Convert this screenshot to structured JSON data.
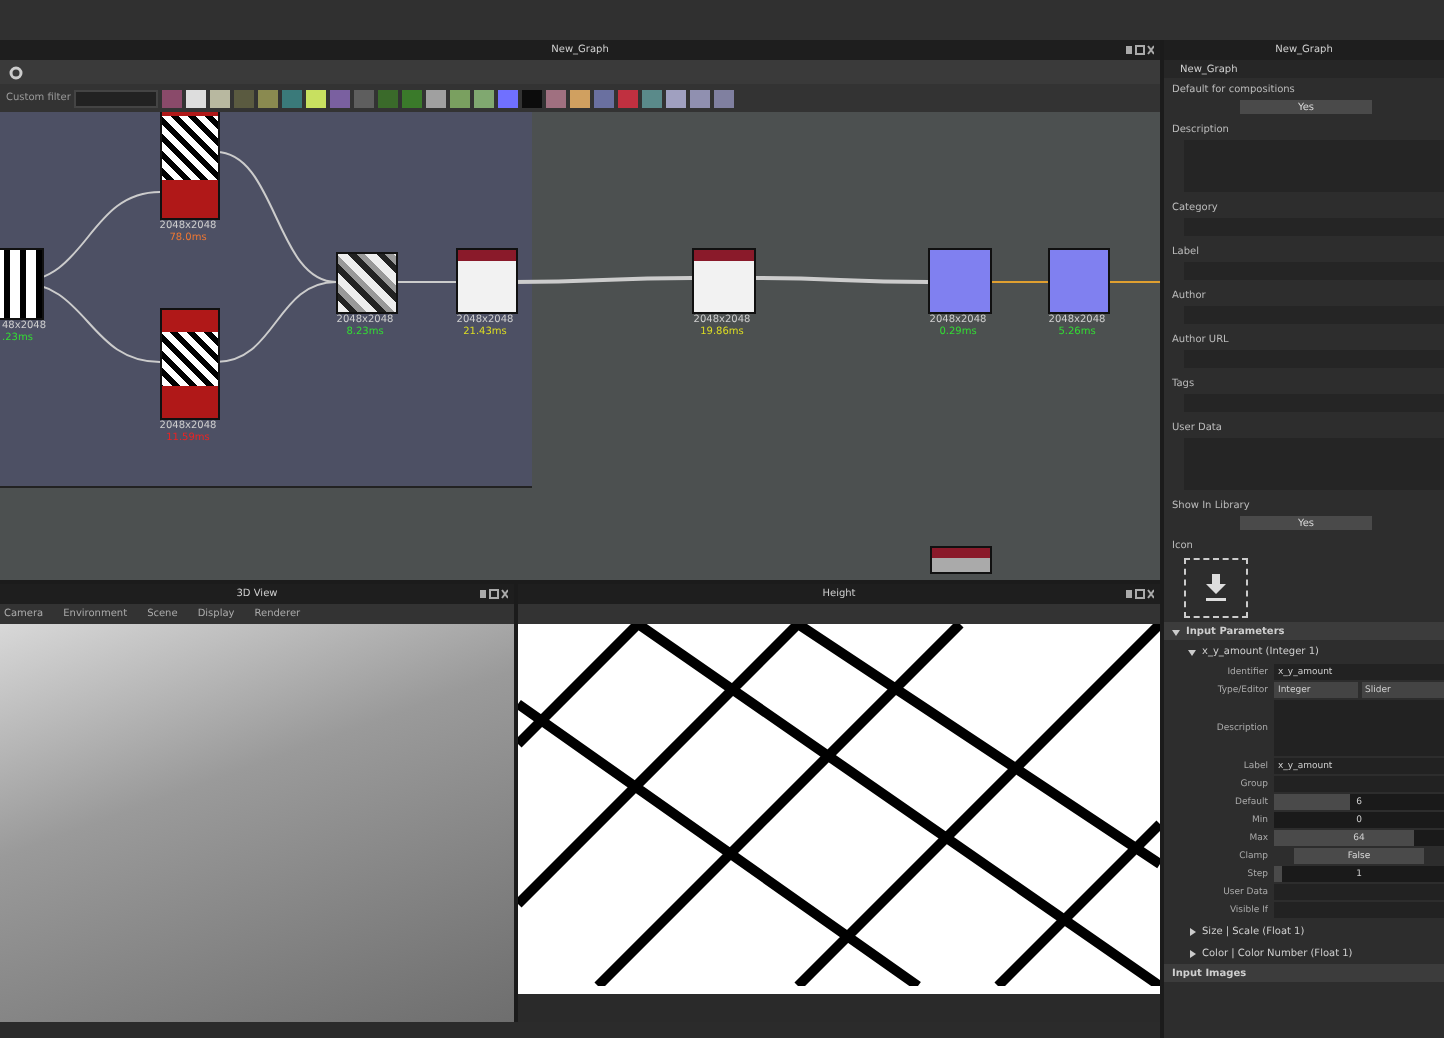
{
  "graph": {
    "title": "New_Graph",
    "filter_label": "Custom filter",
    "nodes": [
      {
        "kind": "stripe",
        "resolution": "48x2048",
        "time": ".23ms",
        "color": "#33dd33"
      },
      {
        "kind": "red",
        "resolution": "2048x2048",
        "time": "78.0ms",
        "color": "#ee7733"
      },
      {
        "kind": "red",
        "resolution": "2048x2048",
        "time": "11.59ms",
        "color": "#ee2222"
      },
      {
        "kind": "gray",
        "resolution": "2048x2048",
        "time": "8.23ms",
        "color": "#33dd33"
      },
      {
        "kind": "white",
        "resolution": "2048x2048",
        "time": "21.43ms",
        "color": "#dddd22"
      },
      {
        "kind": "white",
        "resolution": "2048x2048",
        "time": "19.86ms",
        "color": "#dddd22"
      },
      {
        "kind": "blue",
        "resolution": "2048x2048",
        "time": "0.29ms",
        "color": "#33dd33"
      },
      {
        "kind": "blue",
        "resolution": "2048x2048",
        "time": "5.26ms",
        "color": "#33dd33"
      }
    ]
  },
  "view3d": {
    "title": "3D View",
    "menu": [
      "Camera",
      "Environment",
      "Scene",
      "Display",
      "Renderer"
    ]
  },
  "view2d": {
    "title": "Height"
  },
  "properties": {
    "title": "New_Graph",
    "graph_name": "New_Graph",
    "fields": [
      {
        "kind": "button",
        "label": "Default for compositions",
        "value": "Yes"
      },
      {
        "kind": "area",
        "label": "Description"
      },
      {
        "kind": "text",
        "label": "Category"
      },
      {
        "kind": "text",
        "label": "Label"
      },
      {
        "kind": "text",
        "label": "Author"
      },
      {
        "kind": "text",
        "label": "Author URL"
      },
      {
        "kind": "text",
        "label": "Tags"
      },
      {
        "kind": "area",
        "label": "User Data"
      },
      {
        "kind": "button",
        "label": "Show In Library",
        "value": "Yes"
      },
      {
        "kind": "icon",
        "label": "Icon"
      }
    ],
    "input_parameters": {
      "title": "Input Parameters",
      "params": [
        {
          "name": "x_y_amount (Integer 1)",
          "expanded": true,
          "rows": [
            {
              "kind": "text",
              "label": "Identifier",
              "value": "x_y_amount"
            },
            {
              "kind": "combo",
              "label": "Type/Editor",
              "value": "Integer",
              "value2": "Slider"
            },
            {
              "kind": "area",
              "label": "Description"
            },
            {
              "kind": "text",
              "label": "Label",
              "value": "x_y_amount"
            },
            {
              "kind": "text",
              "label": "Group"
            },
            {
              "kind": "slider",
              "label": "Default",
              "value": "6",
              "level": 0.45
            },
            {
              "kind": "slider",
              "label": "Min",
              "value": "0",
              "level": 0
            },
            {
              "kind": "slider",
              "label": "Max",
              "value": "64",
              "level": 0.82
            },
            {
              "kind": "button",
              "label": "Clamp",
              "value": "False"
            },
            {
              "kind": "slider",
              "label": "Step",
              "value": "1",
              "level": 0.05
            },
            {
              "kind": "text",
              "label": "User Data"
            },
            {
              "kind": "text",
              "label": "Visible If"
            }
          ]
        },
        {
          "name": "Size | Scale (Float 1)",
          "expanded": false
        },
        {
          "name": "Color | Color Number (Float 1)",
          "expanded": false
        }
      ]
    },
    "input_images": {
      "title": "Input Images"
    }
  }
}
